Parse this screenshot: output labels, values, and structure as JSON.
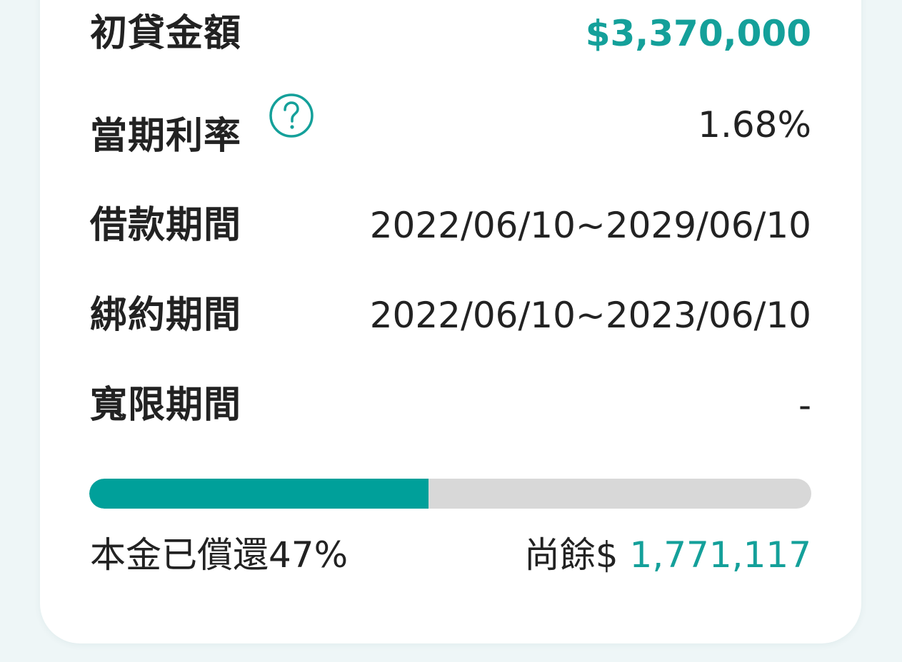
{
  "loan": {
    "initial_amount_label": "初貸金額",
    "initial_amount_value": "$3,370,000",
    "interest_label": "當期利率",
    "interest_value": "1.68%",
    "loan_period_label": "借款期間",
    "loan_period_value": "2022/06/10~2029/06/10",
    "binding_period_label": "綁約期間",
    "binding_period_value": "2022/06/10~2023/06/10",
    "grace_period_label": "寬限期間",
    "grace_period_value": "-"
  },
  "progress": {
    "repaid_fraction": 0.47,
    "repaid_text": "本金已償還47%",
    "remaining_prefix": "尚餘$ ",
    "remaining_amount": "1,771,117"
  },
  "colors": {
    "accent": "#14a09a",
    "progress_fill": "#00a09a",
    "progress_track": "#d8d8d8"
  },
  "icons": {
    "help": "question-circle-icon"
  }
}
